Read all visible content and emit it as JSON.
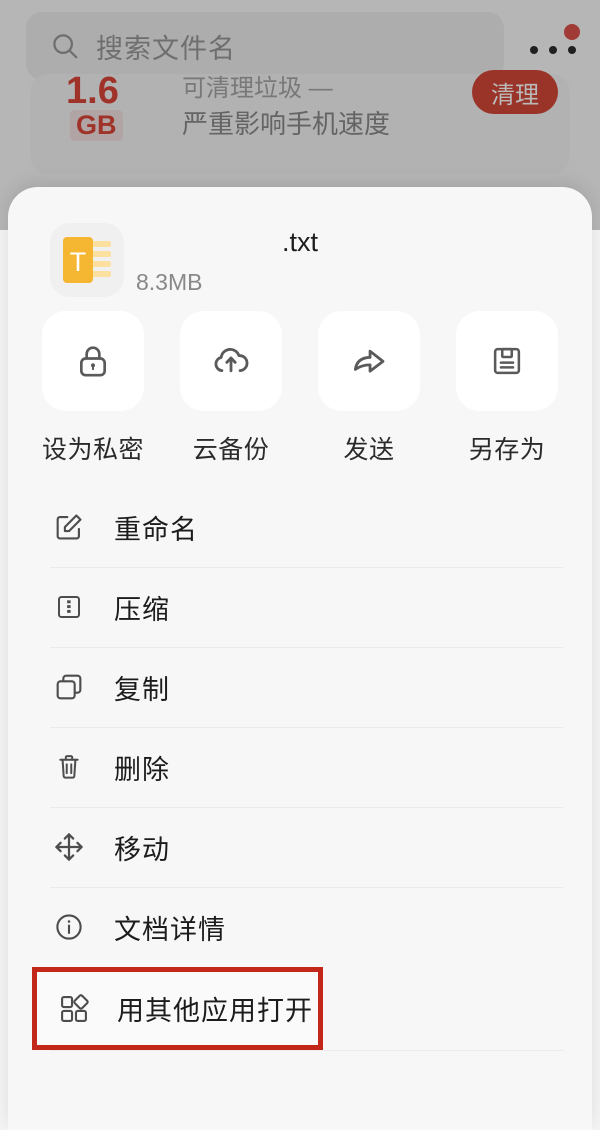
{
  "background": {
    "search": {
      "placeholder": "搜索文件名",
      "icon": "search-icon"
    },
    "more_options": {
      "icon": "more-dots-icon",
      "badge_visible": true,
      "badge_color": "#d83b32"
    },
    "promo_banner": {
      "size_value": "1.6",
      "size_unit": "GB",
      "title": "可清理垃圾 —",
      "subtitle": "严重影响手机速度",
      "button_label": "清理",
      "button_color": "#cf2e1d",
      "accent_color": "#d62e1f"
    }
  },
  "sheet": {
    "file": {
      "name": ".txt",
      "size": "8.3MB",
      "icon": "txt-file-icon",
      "icon_color": "#f5b731"
    },
    "quick_actions": [
      {
        "label": "设为私密",
        "icon": "lock-icon"
      },
      {
        "label": "云备份",
        "icon": "cloud-upload-icon"
      },
      {
        "label": "发送",
        "icon": "share-arrow-icon"
      },
      {
        "label": "另存为",
        "icon": "floppy-save-icon"
      }
    ],
    "menu_items": [
      {
        "label": "重命名",
        "icon": "edit-pencil-icon",
        "highlighted": false
      },
      {
        "label": "压缩",
        "icon": "compress-zip-icon",
        "highlighted": false
      },
      {
        "label": "复制",
        "icon": "copy-icon",
        "highlighted": false
      },
      {
        "label": "删除",
        "icon": "trash-icon",
        "highlighted": false
      },
      {
        "label": "移动",
        "icon": "move-arrows-icon",
        "highlighted": false
      },
      {
        "label": "文档详情",
        "icon": "info-circle-icon",
        "highlighted": false
      },
      {
        "label": "用其他应用打开",
        "icon": "apps-grid-icon",
        "highlighted": true
      }
    ],
    "highlight_color": "#c3271a"
  }
}
